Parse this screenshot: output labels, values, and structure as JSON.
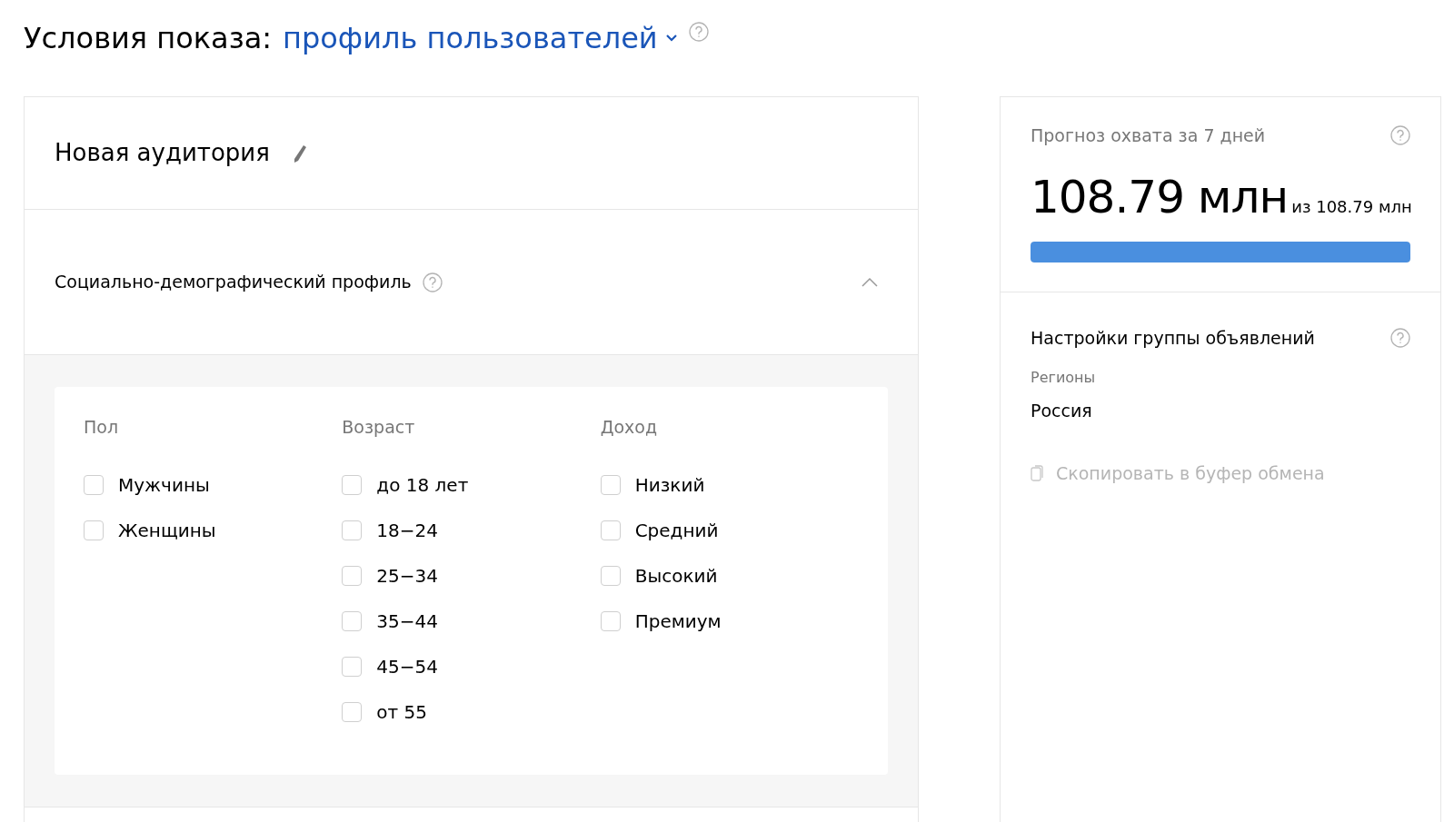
{
  "header": {
    "label": "Условия показа:",
    "value": "профиль пользователей"
  },
  "audience": {
    "title": "Новая аудитория"
  },
  "section": {
    "title": "Социально-демографический профиль",
    "expanded": true
  },
  "groups": [
    {
      "title": "Пол",
      "options": [
        {
          "label": "Мужчины",
          "checked": false
        },
        {
          "label": "Женщины",
          "checked": false
        }
      ]
    },
    {
      "title": "Возраст",
      "options": [
        {
          "label": "до 18 лет",
          "checked": false
        },
        {
          "label": "18−24",
          "checked": false
        },
        {
          "label": "25−34",
          "checked": false
        },
        {
          "label": "35−44",
          "checked": false
        },
        {
          "label": "45−54",
          "checked": false
        },
        {
          "label": "от 55",
          "checked": false
        }
      ]
    },
    {
      "title": "Доход",
      "options": [
        {
          "label": "Низкий",
          "checked": false
        },
        {
          "label": "Средний",
          "checked": false
        },
        {
          "label": "Высокий",
          "checked": false
        },
        {
          "label": "Премиум",
          "checked": false
        }
      ]
    }
  ],
  "forecast": {
    "title": "Прогноз охвата за 7 дней",
    "value": "108.79 млн",
    "total": "из 108.79 млн",
    "level": 1
  },
  "settings": {
    "title": "Настройки группы объявлений",
    "regions_label": "Регионы",
    "regions_value": "Россия",
    "copy": "Скопировать в буфер обмена"
  }
}
